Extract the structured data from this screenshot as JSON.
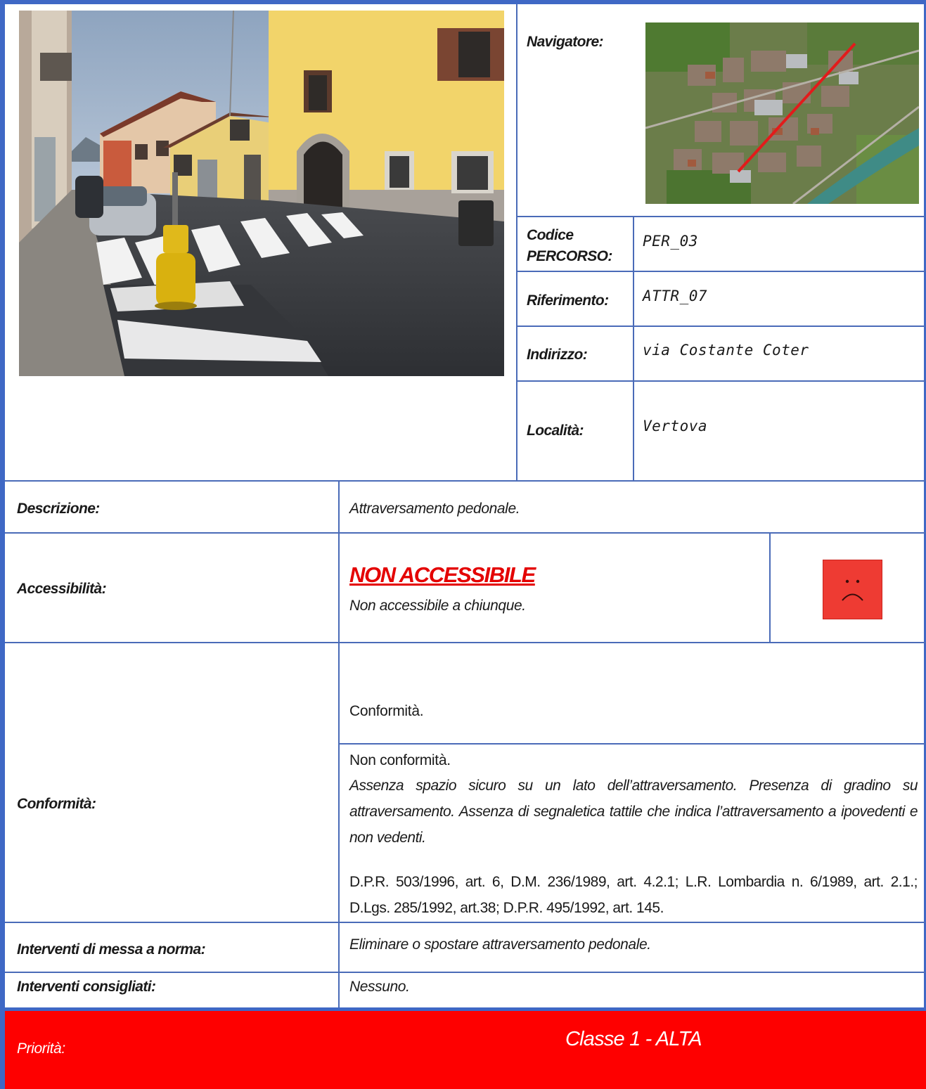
{
  "header": {
    "navigatore_label": "Navigatore:",
    "codice_label": "Codice PERCORSO:",
    "codice_value": "PER_03",
    "riferimento_label": "Riferimento:",
    "riferimento_value": "ATTR_07",
    "indirizzo_label": "Indirizzo:",
    "indirizzo_value": "via Costante Coter",
    "localita_label": "Località:",
    "localita_value": "Vertova"
  },
  "descrizione": {
    "label": "Descrizione:",
    "value": "Attraversamento pedonale."
  },
  "accessibilita": {
    "label": "Accessibilità:",
    "status": "NON ACCESSIBILE",
    "note": "Non accessibile a chiunque.",
    "face_icon": "sad-face-icon",
    "face_color": "#ee3b33"
  },
  "conformita": {
    "label": "Conformità:",
    "conforme_title": "Conformità.",
    "non_conforme_title": "Non conformità.",
    "non_conforme_text": "Assenza spazio sicuro su un lato dell’attraversamento. Presenza di gradino su attraversamento.  Assenza di segnaletica tattile che indica l’attraversamento a ipovedenti e non vedenti.",
    "riferimenti_normativi": "D.P.R. 503/1996, art. 6,  D.M. 236/1989, art. 4.2.1; L.R. Lombardia n. 6/1989, art. 2.1.; D.Lgs. 285/1992, art.38; D.P.R. 495/1992, art. 145."
  },
  "interventi_norma": {
    "label": "Interventi di messa a norma:",
    "value": "Eliminare o spostare attraversamento pedonale."
  },
  "interventi_consigliati": {
    "label": "Interventi consigliati:",
    "value": "Nessuno."
  },
  "priorita": {
    "label": "Priorità:",
    "value": "Classe 1 - ALTA",
    "bar_color": "#fe0000"
  },
  "colors": {
    "frame": "#3f68c5",
    "status_red": "#e40000"
  }
}
